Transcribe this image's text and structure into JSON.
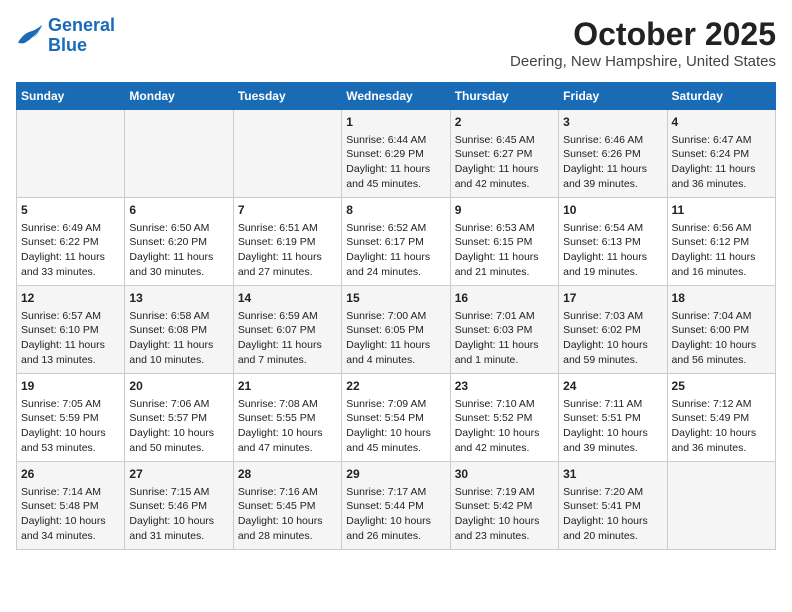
{
  "header": {
    "logo_line1": "General",
    "logo_line2": "Blue",
    "month": "October 2025",
    "location": "Deering, New Hampshire, United States"
  },
  "days_of_week": [
    "Sunday",
    "Monday",
    "Tuesday",
    "Wednesday",
    "Thursday",
    "Friday",
    "Saturday"
  ],
  "weeks": [
    [
      {
        "day": "",
        "content": ""
      },
      {
        "day": "",
        "content": ""
      },
      {
        "day": "",
        "content": ""
      },
      {
        "day": "1",
        "content": "Sunrise: 6:44 AM\nSunset: 6:29 PM\nDaylight: 11 hours and 45 minutes."
      },
      {
        "day": "2",
        "content": "Sunrise: 6:45 AM\nSunset: 6:27 PM\nDaylight: 11 hours and 42 minutes."
      },
      {
        "day": "3",
        "content": "Sunrise: 6:46 AM\nSunset: 6:26 PM\nDaylight: 11 hours and 39 minutes."
      },
      {
        "day": "4",
        "content": "Sunrise: 6:47 AM\nSunset: 6:24 PM\nDaylight: 11 hours and 36 minutes."
      }
    ],
    [
      {
        "day": "5",
        "content": "Sunrise: 6:49 AM\nSunset: 6:22 PM\nDaylight: 11 hours and 33 minutes."
      },
      {
        "day": "6",
        "content": "Sunrise: 6:50 AM\nSunset: 6:20 PM\nDaylight: 11 hours and 30 minutes."
      },
      {
        "day": "7",
        "content": "Sunrise: 6:51 AM\nSunset: 6:19 PM\nDaylight: 11 hours and 27 minutes."
      },
      {
        "day": "8",
        "content": "Sunrise: 6:52 AM\nSunset: 6:17 PM\nDaylight: 11 hours and 24 minutes."
      },
      {
        "day": "9",
        "content": "Sunrise: 6:53 AM\nSunset: 6:15 PM\nDaylight: 11 hours and 21 minutes."
      },
      {
        "day": "10",
        "content": "Sunrise: 6:54 AM\nSunset: 6:13 PM\nDaylight: 11 hours and 19 minutes."
      },
      {
        "day": "11",
        "content": "Sunrise: 6:56 AM\nSunset: 6:12 PM\nDaylight: 11 hours and 16 minutes."
      }
    ],
    [
      {
        "day": "12",
        "content": "Sunrise: 6:57 AM\nSunset: 6:10 PM\nDaylight: 11 hours and 13 minutes."
      },
      {
        "day": "13",
        "content": "Sunrise: 6:58 AM\nSunset: 6:08 PM\nDaylight: 11 hours and 10 minutes."
      },
      {
        "day": "14",
        "content": "Sunrise: 6:59 AM\nSunset: 6:07 PM\nDaylight: 11 hours and 7 minutes."
      },
      {
        "day": "15",
        "content": "Sunrise: 7:00 AM\nSunset: 6:05 PM\nDaylight: 11 hours and 4 minutes."
      },
      {
        "day": "16",
        "content": "Sunrise: 7:01 AM\nSunset: 6:03 PM\nDaylight: 11 hours and 1 minute."
      },
      {
        "day": "17",
        "content": "Sunrise: 7:03 AM\nSunset: 6:02 PM\nDaylight: 10 hours and 59 minutes."
      },
      {
        "day": "18",
        "content": "Sunrise: 7:04 AM\nSunset: 6:00 PM\nDaylight: 10 hours and 56 minutes."
      }
    ],
    [
      {
        "day": "19",
        "content": "Sunrise: 7:05 AM\nSunset: 5:59 PM\nDaylight: 10 hours and 53 minutes."
      },
      {
        "day": "20",
        "content": "Sunrise: 7:06 AM\nSunset: 5:57 PM\nDaylight: 10 hours and 50 minutes."
      },
      {
        "day": "21",
        "content": "Sunrise: 7:08 AM\nSunset: 5:55 PM\nDaylight: 10 hours and 47 minutes."
      },
      {
        "day": "22",
        "content": "Sunrise: 7:09 AM\nSunset: 5:54 PM\nDaylight: 10 hours and 45 minutes."
      },
      {
        "day": "23",
        "content": "Sunrise: 7:10 AM\nSunset: 5:52 PM\nDaylight: 10 hours and 42 minutes."
      },
      {
        "day": "24",
        "content": "Sunrise: 7:11 AM\nSunset: 5:51 PM\nDaylight: 10 hours and 39 minutes."
      },
      {
        "day": "25",
        "content": "Sunrise: 7:12 AM\nSunset: 5:49 PM\nDaylight: 10 hours and 36 minutes."
      }
    ],
    [
      {
        "day": "26",
        "content": "Sunrise: 7:14 AM\nSunset: 5:48 PM\nDaylight: 10 hours and 34 minutes."
      },
      {
        "day": "27",
        "content": "Sunrise: 7:15 AM\nSunset: 5:46 PM\nDaylight: 10 hours and 31 minutes."
      },
      {
        "day": "28",
        "content": "Sunrise: 7:16 AM\nSunset: 5:45 PM\nDaylight: 10 hours and 28 minutes."
      },
      {
        "day": "29",
        "content": "Sunrise: 7:17 AM\nSunset: 5:44 PM\nDaylight: 10 hours and 26 minutes."
      },
      {
        "day": "30",
        "content": "Sunrise: 7:19 AM\nSunset: 5:42 PM\nDaylight: 10 hours and 23 minutes."
      },
      {
        "day": "31",
        "content": "Sunrise: 7:20 AM\nSunset: 5:41 PM\nDaylight: 10 hours and 20 minutes."
      },
      {
        "day": "",
        "content": ""
      }
    ]
  ]
}
